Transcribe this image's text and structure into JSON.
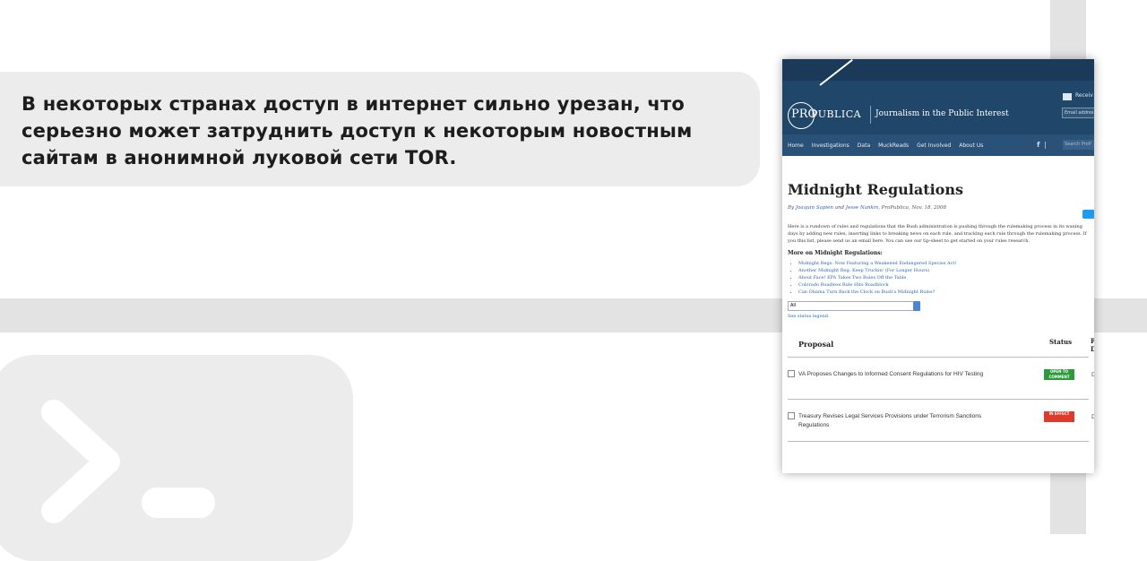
{
  "slide": {
    "caption": "В некоторых странах доступ в интернет сильно урезан, что серьезно может затруднить доступ к некоторым новостным сайтам в анонимной луковой сети TOR."
  },
  "site": {
    "logo": {
      "pro": "PRO",
      "publica": "PUBLICA"
    },
    "tagline": "Journalism in the Public Interest",
    "receive_label": "Receiv",
    "email_placeholder": "Email addres",
    "nav": [
      "Home",
      "Investigations",
      "Data",
      "MuckReads",
      "Get Involved",
      "About Us"
    ],
    "social": "f  ❘",
    "search_placeholder": "Search ProP"
  },
  "article": {
    "title": "Midnight Regulations",
    "byline_prefix": "By",
    "author1": "Joaquin Sapien",
    "byline_and": "and",
    "author2": "Jesse Nankin",
    "byline_suffix": ", ProPublica, Nov. 18, 2008",
    "intro": "Here is a rundown of rules and regulations that the Bush administration is pushing through the rulemaking process in its waning days by adding new rules, inserting links to breaking news on each rule, and tracking each rule through the rulemaking process. If you this list, please send us an email here. You can use our tip-sheet to get started on your rules research.",
    "more_heading": "More on Midnight Regulations:",
    "more_links": [
      "Midnight Regs: Now Featuring a Weakened Endangered Species Act!",
      "Another Midnight Reg: Keep Truckin' (For Longer Hours)",
      "About Face! EPA Takes Two Rules Off the Table",
      "Colorado Roadless Rule Hits Roadblock",
      "Can Obama Turn Back the Clock on Bush's Midnight Rules?"
    ],
    "filter_value": "All",
    "status_legend": "See status legend."
  },
  "table": {
    "headers": {
      "proposal": "Proposal",
      "status": "Status",
      "p": "P D"
    },
    "rows": [
      {
        "text": "VA Proposes Changes to Informed Consent Regulations for HIV Testing",
        "status": "OPEN TO COMMENT",
        "status_color": "#2a9a3a",
        "d": "D"
      },
      {
        "text": "Treasury Revises Legal Services Provisions under Terrorism Sanctions Regulations",
        "status": "IN EFFECT",
        "status_color": "#e03a2a",
        "d": "D"
      }
    ]
  }
}
